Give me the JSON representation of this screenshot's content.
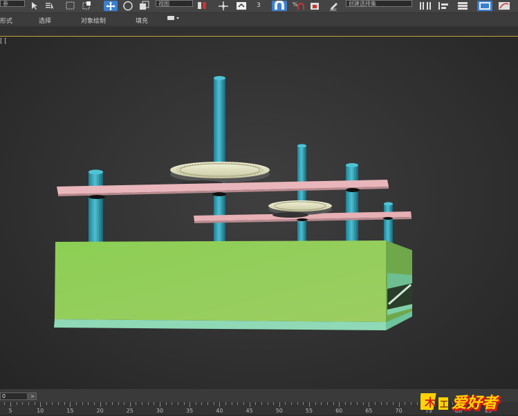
{
  "toolbar": {
    "view_dropdown": "视图",
    "selection_set_dropdown": "创建选择集"
  },
  "ribbon": {
    "tabs": [
      "形式",
      "选择",
      "对象绘制",
      "填充"
    ]
  },
  "viewport": {
    "label": "[ ["
  },
  "timeline": {
    "frame_label": "0",
    "next_label": ">",
    "ruler_ticks": [
      "5",
      "10",
      "15",
      "20",
      "25",
      "30",
      "35",
      "40",
      "45",
      "50",
      "55",
      "60",
      "65",
      "70",
      "75",
      "80",
      "85"
    ]
  },
  "logo": {
    "text": "爱好者",
    "prefix": "木工",
    "colors": {
      "fill": "#ffd400",
      "shadow": "#d21b1b"
    }
  },
  "scene_colors": {
    "base_green": "#94c95c",
    "base_bottom": "#8fd9b7",
    "plate_pink": "#e7b2b8",
    "shaft_teal": "#2a9aaf",
    "gear_cream": "#e8e8c4"
  }
}
